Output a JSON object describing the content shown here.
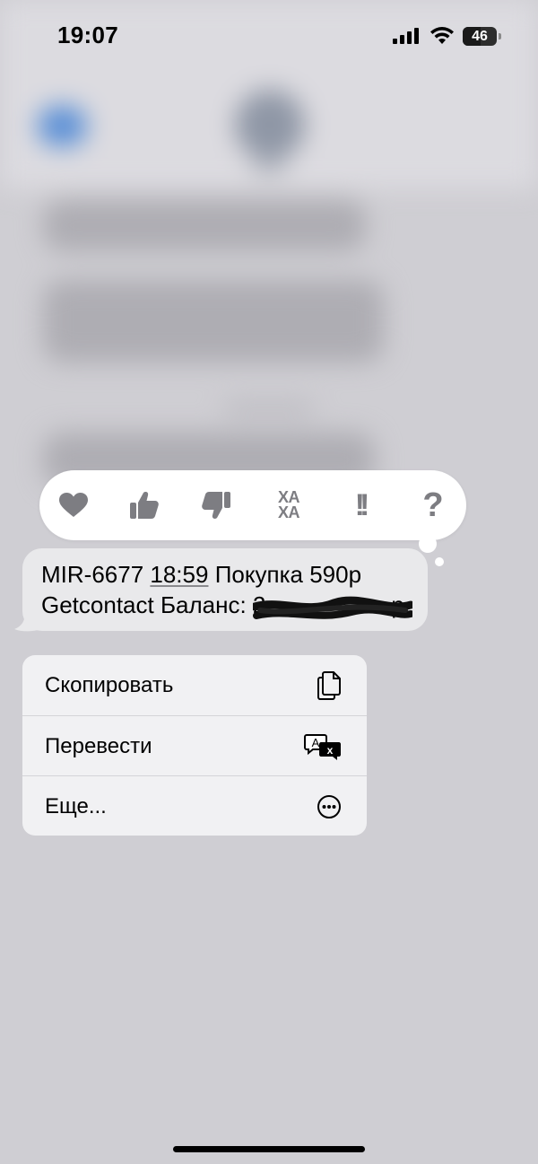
{
  "status_bar": {
    "time": "19:07",
    "battery_level": "46"
  },
  "tapback": {
    "reactions": [
      {
        "name": "heart",
        "icon": "heart-icon"
      },
      {
        "name": "thumbs-up",
        "icon": "thumbs-up-icon"
      },
      {
        "name": "thumbs-down",
        "icon": "thumbs-down-icon"
      },
      {
        "name": "haha",
        "icon": "haha-icon",
        "text_top": "ХА",
        "text_bottom": "ХА"
      },
      {
        "name": "emphasize",
        "icon": "exclamation-icon",
        "text": "!!"
      },
      {
        "name": "question",
        "icon": "question-icon",
        "text": "?"
      }
    ]
  },
  "message": {
    "sender_code": "MIR-6677",
    "time": "18:59",
    "line1_rest": "Покупка 590р",
    "line2": "Getcontact Баланс: 2",
    "line2_tail": "р"
  },
  "context_menu": {
    "items": [
      {
        "label": "Скопировать",
        "icon": "copy-icon"
      },
      {
        "label": "Перевести",
        "icon": "translate-icon"
      },
      {
        "label": "Еще...",
        "icon": "more-icon"
      }
    ]
  },
  "colors": {
    "background": "#cfced3",
    "bubble": "#e9e9eb",
    "menu": "#f1f1f3",
    "reaction_icon": "#7d7d82"
  }
}
